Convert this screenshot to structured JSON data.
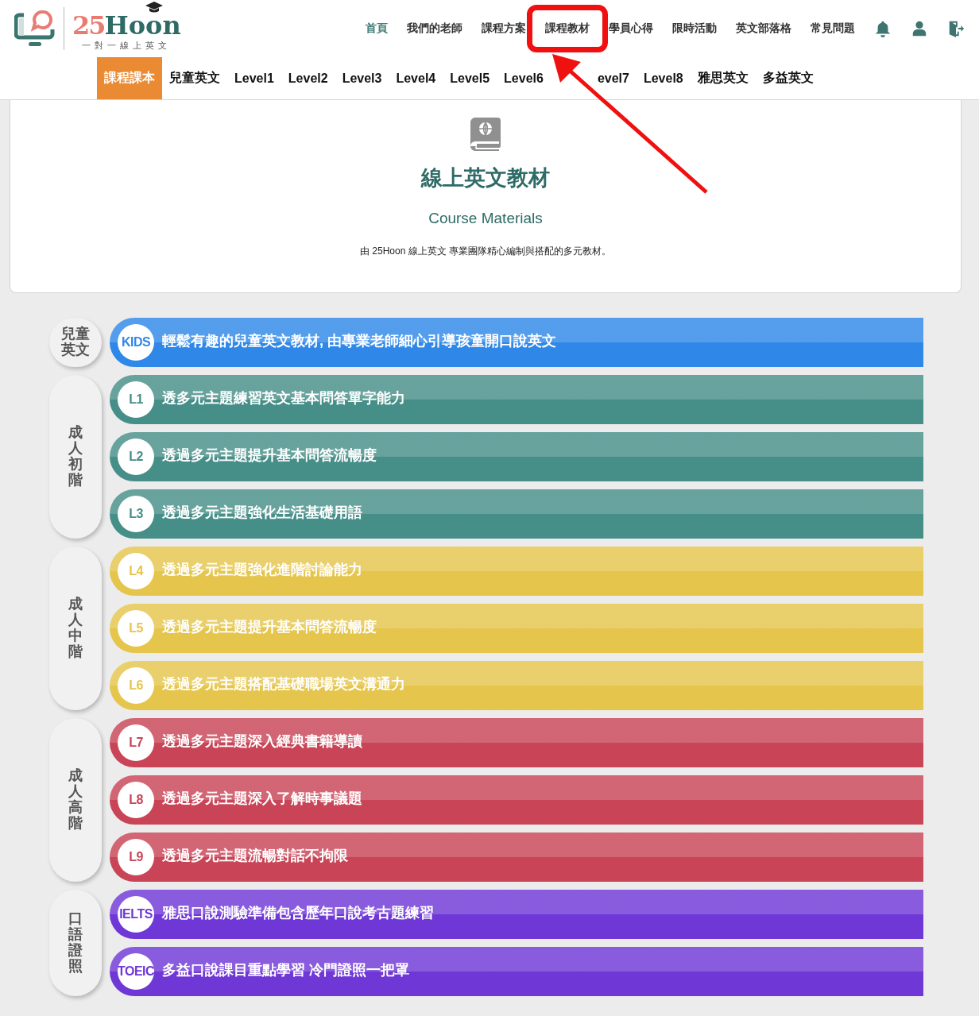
{
  "logo": {
    "number": "25",
    "name": "Hoon",
    "tagline": "一對一線上英文"
  },
  "nav": [
    {
      "label": "首頁",
      "selected": true,
      "highlighted": false
    },
    {
      "label": "我們的老師",
      "selected": false,
      "highlighted": false
    },
    {
      "label": "課程方案",
      "selected": false,
      "highlighted": false
    },
    {
      "label": "課程教材",
      "selected": false,
      "highlighted": true
    },
    {
      "label": "學員心得",
      "selected": false,
      "highlighted": false
    },
    {
      "label": "限時活動",
      "selected": false,
      "highlighted": false
    },
    {
      "label": "英文部落格",
      "selected": false,
      "highlighted": false
    },
    {
      "label": "常見問題",
      "selected": false,
      "highlighted": false
    }
  ],
  "subnav": [
    {
      "label": "課程課本",
      "selected": true,
      "arrow": false
    },
    {
      "label": "兒童英文",
      "selected": false,
      "arrow": false
    },
    {
      "label": "Level1",
      "selected": false,
      "arrow": false
    },
    {
      "label": "Level2",
      "selected": false,
      "arrow": false
    },
    {
      "label": "Level3",
      "selected": false,
      "arrow": false
    },
    {
      "label": "Level4",
      "selected": false,
      "arrow": false
    },
    {
      "label": "Level5",
      "selected": false,
      "arrow": false
    },
    {
      "label": "Level6",
      "selected": false,
      "arrow": false
    },
    {
      "label": "evel7",
      "selected": false,
      "arrow": true
    },
    {
      "label": "Level8",
      "selected": false,
      "arrow": false
    },
    {
      "label": "雅思英文",
      "selected": false,
      "arrow": false
    },
    {
      "label": "多益英文",
      "selected": false,
      "arrow": false
    }
  ],
  "intro": {
    "title": "線上英文教材",
    "subtitle": "Course Materials",
    "description": "由 25Hoon 線上英文 專業團隊精心編制與搭配的多元教材。"
  },
  "groups": [
    {
      "label": "兒童英文",
      "courses": [
        {
          "tag": "KIDS",
          "text": "輕鬆有趣的兒童英文教材, 由專業老師細心引導孩童開口說英文",
          "color": "#2f88e8"
        }
      ]
    },
    {
      "label": "成人初階",
      "courses": [
        {
          "tag": "L1",
          "text": "透多元主題練習英文基本問答單字能力",
          "color": "#468e88"
        },
        {
          "tag": "L2",
          "text": "透過多元主題提升基本問答流暢度",
          "color": "#468e88"
        },
        {
          "tag": "L3",
          "text": "透過多元主題強化生活基礎用語",
          "color": "#468e88"
        }
      ]
    },
    {
      "label": "成人中階",
      "courses": [
        {
          "tag": "L4",
          "text": "透過多元主題強化進階討論能力",
          "color": "#e5c54c"
        },
        {
          "tag": "L5",
          "text": "透過多元主題提升基本問答流暢度",
          "color": "#e5c54c"
        },
        {
          "tag": "L6",
          "text": "透過多元主題搭配基礎職場英文溝通力",
          "color": "#e5c54c"
        }
      ]
    },
    {
      "label": "成人高階",
      "courses": [
        {
          "tag": "L7",
          "text": "透過多元主題深入經典書籍導讀",
          "color": "#c84456"
        },
        {
          "tag": "L8",
          "text": "透過多元主題深入了解時事議題",
          "color": "#c84456"
        },
        {
          "tag": "L9",
          "text": "透過多元主題流暢對話不拘限",
          "color": "#c84456"
        }
      ]
    },
    {
      "label": "口語證照",
      "courses": [
        {
          "tag": "IELTS",
          "text": "雅思口說測驗準備包含歷年口說考古題練習",
          "color": "#6f37d6"
        },
        {
          "tag": "TOEIC",
          "text": "多益口說課目重點學習 冷門證照一把罩",
          "color": "#6f37d6"
        }
      ]
    }
  ]
}
